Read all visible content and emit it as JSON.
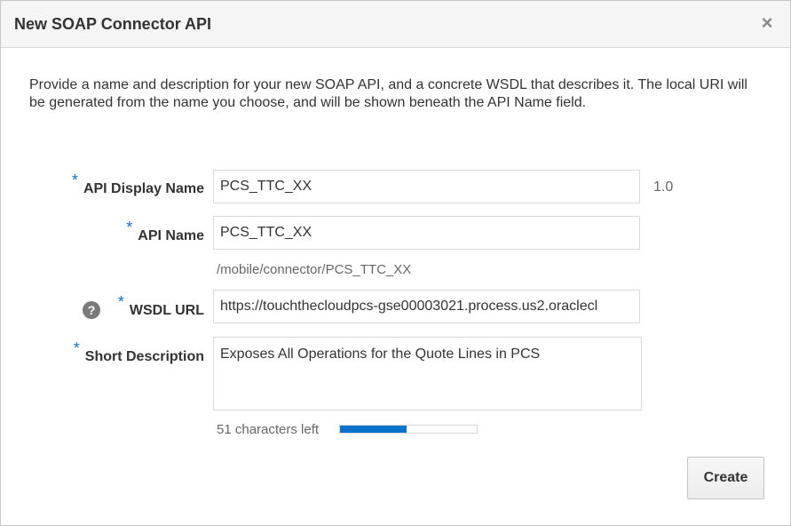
{
  "dialog": {
    "title": "New SOAP Connector API",
    "close_glyph": "×",
    "intro": "Provide a name and description for your new SOAP API, and a concrete WSDL that describes it. The local URI will be generated from the name you choose, and will be shown beneath the API Name field."
  },
  "required_marker": "*",
  "form": {
    "display_name": {
      "label": "API Display Name",
      "value": "PCS_TTC_XX",
      "version": "1.0"
    },
    "api_name": {
      "label": "API Name",
      "value": "PCS_TTC_XX",
      "uri": "/mobile/connector/PCS_TTC_XX"
    },
    "wsdl_url": {
      "label": "WSDL URL",
      "help_glyph": "?",
      "value": "https://touchthecloudpcs-gse00003021.process.us2.oraclecl"
    },
    "short_description": {
      "label": "Short Description",
      "value": "Exposes All Operations for the Quote Lines in PCS",
      "chars_left": "51 characters left",
      "used_fraction": 0.49
    }
  },
  "actions": {
    "create_label": "Create"
  },
  "icons": {
    "close": "close-icon",
    "help": "help-icon"
  },
  "colors": {
    "accent": "#0a72c9",
    "required": "#1a6fc4"
  }
}
